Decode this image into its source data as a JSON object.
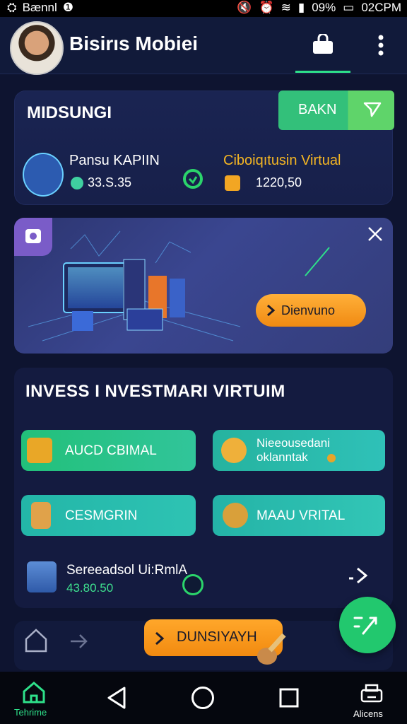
{
  "status_bar": {
    "carrier": "Bænnl",
    "battery": "09%",
    "time": "02CPM"
  },
  "header": {
    "title": "Bisirıs Mobiei"
  },
  "card": {
    "title": "MIDSUNGI",
    "bank_button": "BAKN",
    "account": {
      "name": "Pansu KAPIIN",
      "value": "33.S.35"
    },
    "virtual": {
      "name": "Ciboiqıtusin Virtual",
      "value": "1220,50"
    }
  },
  "banner": {
    "button": "Dienvuno"
  },
  "invest": {
    "title": "INVESS I NVESTMARI VIRTUIM",
    "tiles": [
      {
        "label": "AUCD CBIMAL"
      },
      {
        "label": "Nieeousedani oklanntak"
      },
      {
        "label": "CESMGRIN"
      },
      {
        "label": "MAAU VRITAL"
      }
    ],
    "item": {
      "name": "Sereeadsol Ui:RmlA",
      "value": "43.80.50"
    }
  },
  "cta": {
    "label": "DUNSIYAYH"
  },
  "nav": {
    "home_label": "Tehrime",
    "alt_label": "Alicens"
  },
  "colors": {
    "accent_green": "#22c86e",
    "accent_orange": "#f5a32a",
    "bg": "#0e1430"
  }
}
